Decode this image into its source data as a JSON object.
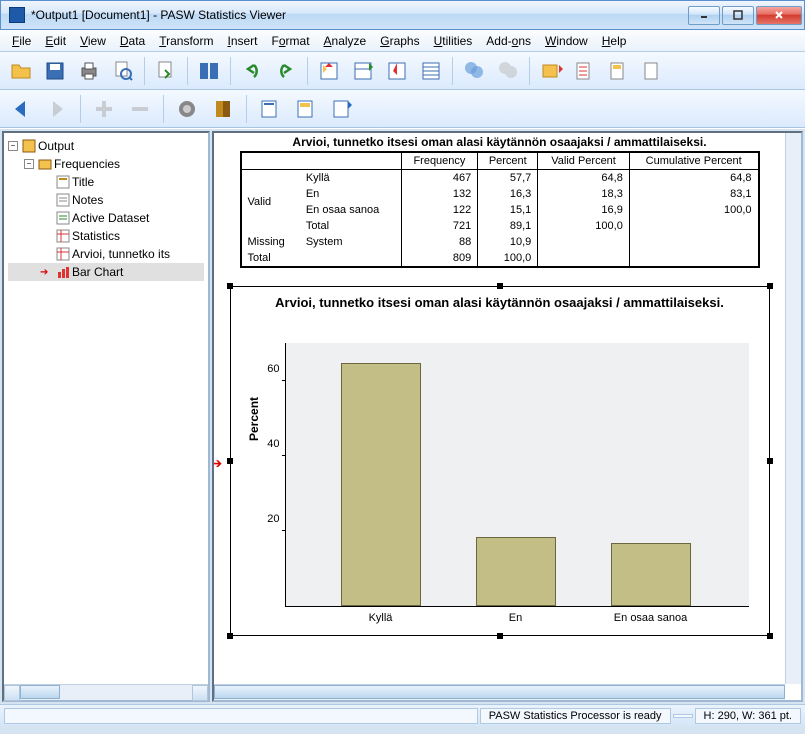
{
  "window": {
    "title": "*Output1 [Document1] - PASW Statistics Viewer"
  },
  "menu": {
    "file": "File",
    "edit": "Edit",
    "view": "View",
    "data": "Data",
    "transform": "Transform",
    "insert": "Insert",
    "format": "Format",
    "analyze": "Analyze",
    "graphs": "Graphs",
    "utilities": "Utilities",
    "addons": "Add-ons",
    "window": "Window",
    "help": "Help"
  },
  "tree": {
    "root": "Output",
    "freq": "Frequencies",
    "title": "Title",
    "notes": "Notes",
    "activeds": "Active Dataset",
    "stats": "Statistics",
    "arvioi": "Arvioi, tunnetko its",
    "barchart": "Bar Chart"
  },
  "table": {
    "caption": "Arvioi, tunnetko itsesi oman alasi käytännön osaajaksi / ammattilaiseksi.",
    "headers": {
      "freq": "Frequency",
      "pct": "Percent",
      "vpct": "Valid Percent",
      "cpct": "Cumulative Percent"
    },
    "valid_label": "Valid",
    "missing_label": "Missing",
    "system_label": "System",
    "total_label": "Total",
    "rows": [
      {
        "cat": "Kyllä",
        "freq": "467",
        "pct": "57,7",
        "vpct": "64,8",
        "cpct": "64,8"
      },
      {
        "cat": "En",
        "freq": "132",
        "pct": "16,3",
        "vpct": "18,3",
        "cpct": "83,1"
      },
      {
        "cat": "En osaa sanoa",
        "freq": "122",
        "pct": "15,1",
        "vpct": "16,9",
        "cpct": "100,0"
      },
      {
        "cat": "Total",
        "freq": "721",
        "pct": "89,1",
        "vpct": "100,0",
        "cpct": ""
      }
    ],
    "missing": {
      "freq": "88",
      "pct": "10,9"
    },
    "grand": {
      "freq": "809",
      "pct": "100,0"
    }
  },
  "chart_data": {
    "type": "bar",
    "title": "Arvioi, tunnetko itsesi oman alasi käytännön osaajaksi / ammattilaiseksi.",
    "ylabel": "Percent",
    "xlabel": "",
    "categories": [
      "Kyllä",
      "En",
      "En osaa sanoa"
    ],
    "values": [
      64.8,
      18.3,
      16.9
    ],
    "ylim": [
      0,
      70
    ],
    "yticks": [
      20,
      40,
      60
    ]
  },
  "status": {
    "ready": "PASW Statistics Processor is ready",
    "dims": "H: 290, W: 361 pt."
  }
}
